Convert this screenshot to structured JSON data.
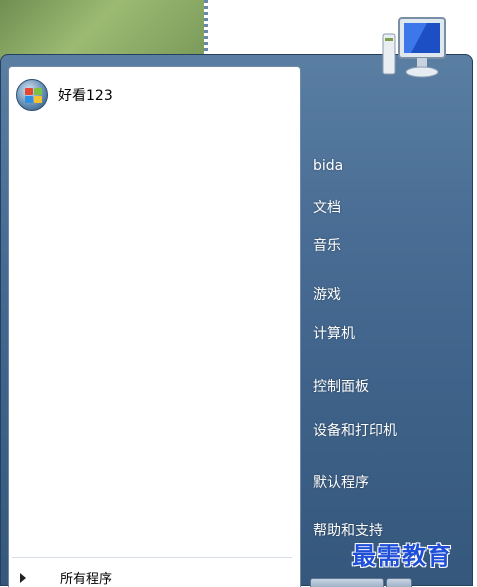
{
  "user": {
    "name": "好看123"
  },
  "left_pane": {
    "all_programs_label": "所有程序"
  },
  "right_pane": {
    "items": [
      {
        "label": "bida"
      },
      {
        "label": "文档"
      },
      {
        "label": "音乐"
      },
      {
        "label": "游戏"
      },
      {
        "label": "计算机"
      },
      {
        "label": "控制面板"
      },
      {
        "label": "设备和打印机"
      },
      {
        "label": "默认程序"
      },
      {
        "label": "帮助和支持"
      }
    ]
  },
  "watermark": {
    "text": "最需教育"
  },
  "icons": {
    "user_picture": "windows-logo-icon",
    "top_right": "monitor-icon",
    "all_programs": "triangle-right-icon"
  },
  "colors": {
    "menu_top": "#5a7fa3",
    "menu_bottom": "#35577c",
    "watermark": "#1f4fd6"
  }
}
